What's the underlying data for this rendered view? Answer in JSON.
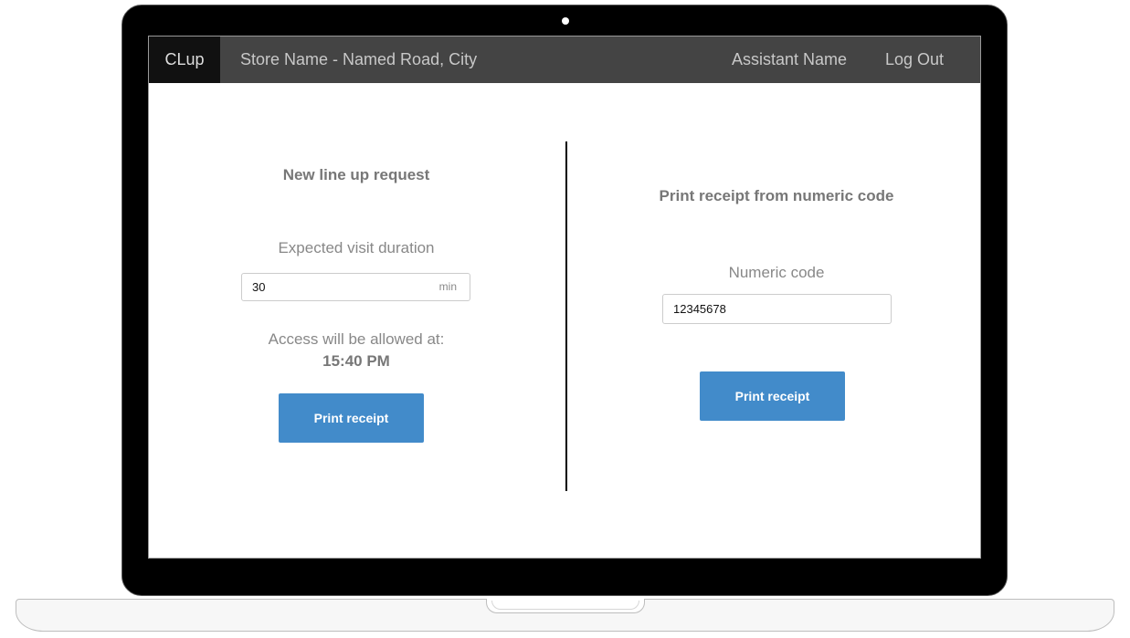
{
  "navbar": {
    "brand": "CLup",
    "store": "Store Name - Named Road, City",
    "assistant": "Assistant Name",
    "logout": "Log Out"
  },
  "left_panel": {
    "title": "New line up request",
    "duration_label": "Expected visit duration",
    "duration_value": "30",
    "duration_unit": "min",
    "access_label": "Access will be allowed at:",
    "access_time": "15:40 PM",
    "button": "Print receipt"
  },
  "right_panel": {
    "title": "Print receipt from numeric code",
    "code_label": "Numeric code",
    "code_value": "12345678",
    "button": "Print receipt"
  },
  "colors": {
    "navbar": "#444444",
    "brand_bg": "#111111",
    "button": "#428bca"
  }
}
